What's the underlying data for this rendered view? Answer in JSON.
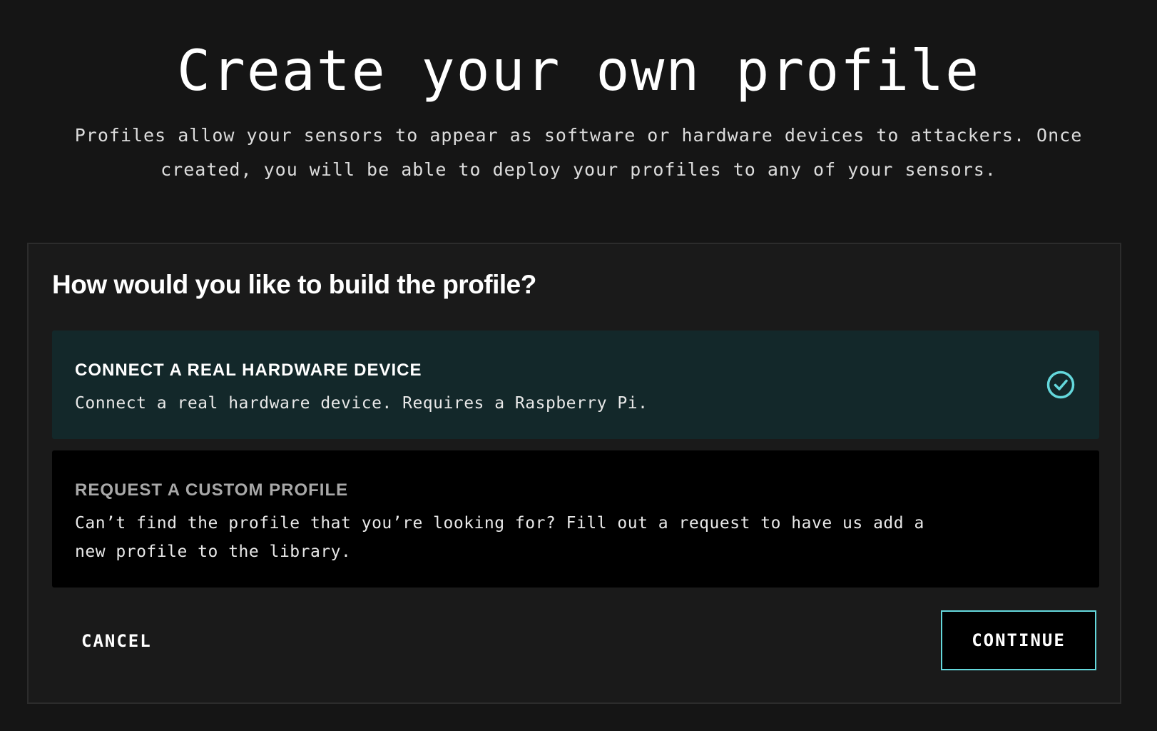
{
  "page": {
    "title": "Create your own profile",
    "subtitle": "Profiles allow your sensors to appear as software or hardware devices to attackers. Once created, you will be able to deploy your profiles to any of your sensors."
  },
  "panel": {
    "question": "How would you like to build the profile?",
    "options": [
      {
        "title": "CONNECT A REAL HARDWARE DEVICE",
        "description": "Connect a real hardware device. Requires a Raspberry Pi.",
        "selected": true,
        "icon": "check-circle-icon"
      },
      {
        "title": "REQUEST A CUSTOM PROFILE",
        "description": "Can’t find the profile that you’re looking for? Fill out a request to have us add a new profile to the library.",
        "selected": false
      }
    ]
  },
  "actions": {
    "cancel_label": "CANCEL",
    "continue_label": "CONTINUE"
  },
  "colors": {
    "background": "#151515",
    "panel": "#1a1a1a",
    "selected_option": "#13282a",
    "unselected_option": "#000000",
    "accent": "#64d8dc"
  }
}
